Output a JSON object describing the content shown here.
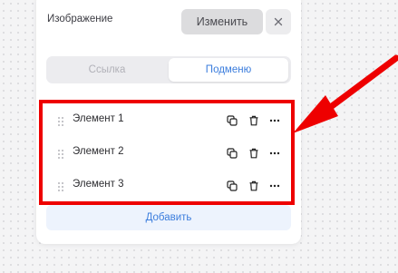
{
  "image_section": {
    "label": "Изображение",
    "change_label": "Изменить"
  },
  "tabs": [
    {
      "label": "Ссылка",
      "active": false
    },
    {
      "label": "Подменю",
      "active": true
    }
  ],
  "items": [
    {
      "label": "Элемент 1"
    },
    {
      "label": "Элемент 2"
    },
    {
      "label": "Элемент 3"
    }
  ],
  "add_label": "Добавить",
  "icons": {
    "close": "close-icon",
    "drag": "drag-handle-icon",
    "copy": "copy-icon",
    "delete": "trash-icon",
    "more": "more-icon"
  },
  "colors": {
    "accent": "#3b7ddd",
    "highlight": "#ee0000",
    "add_background": "#edf3fd"
  }
}
